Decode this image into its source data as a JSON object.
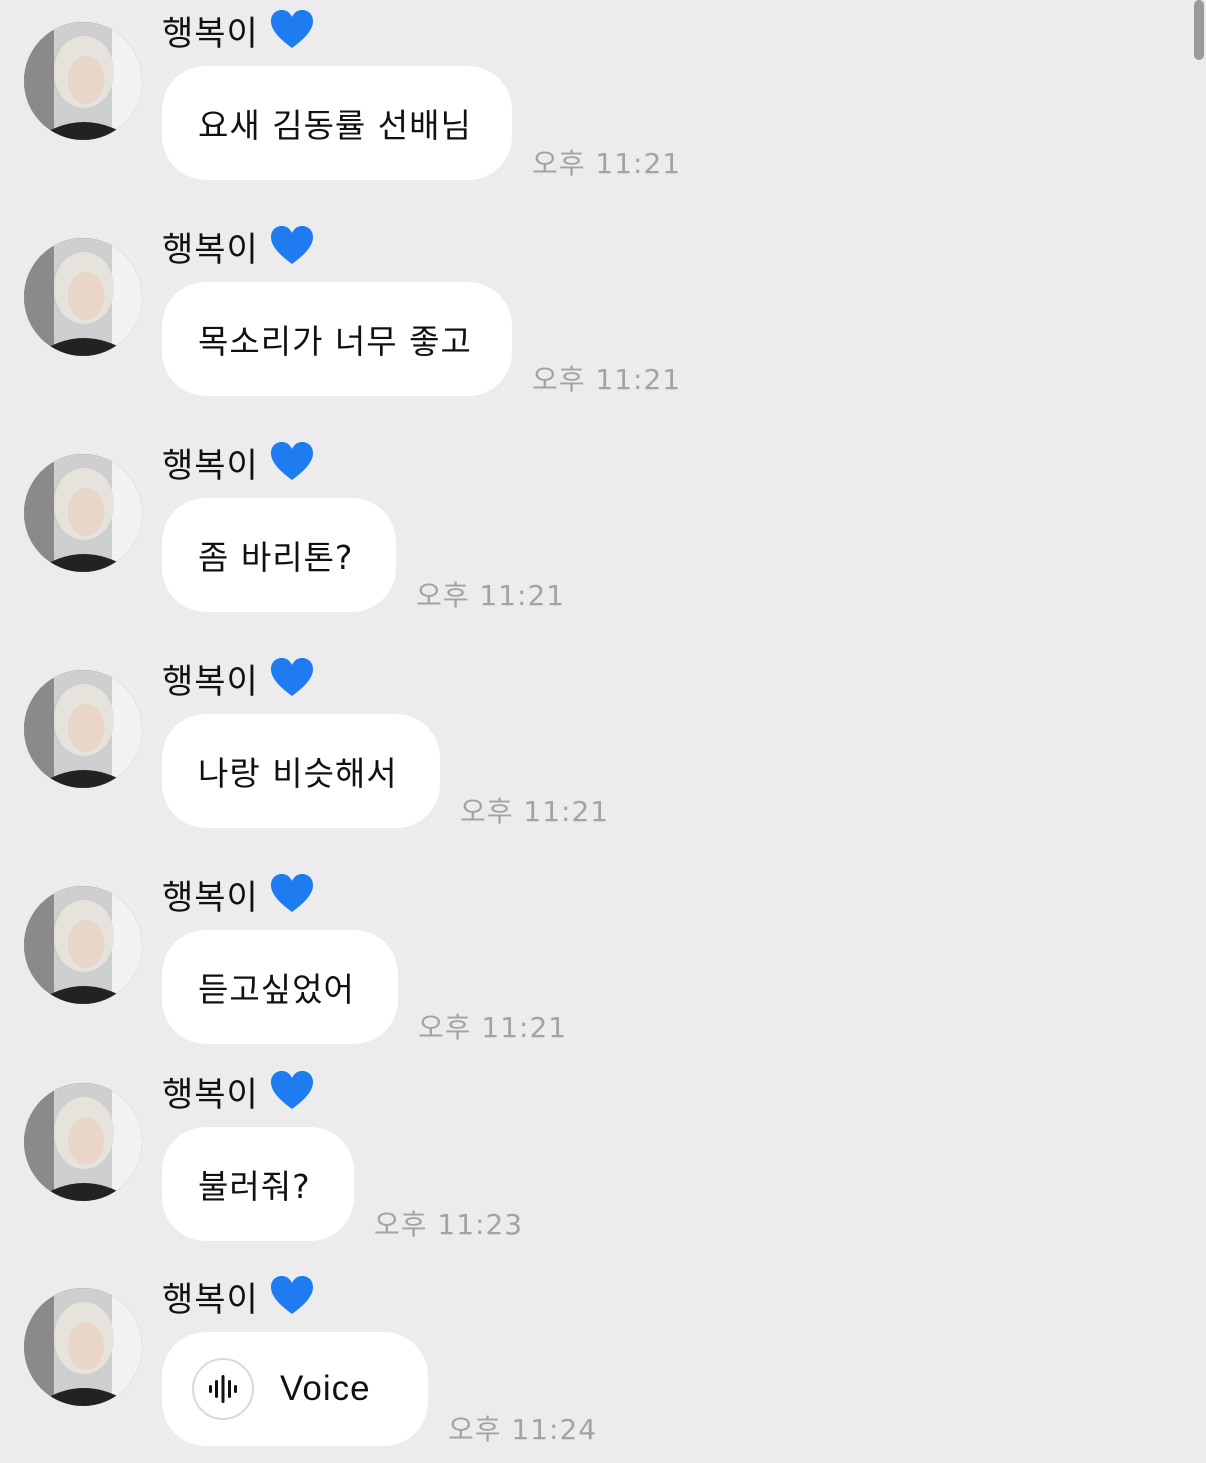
{
  "messages": [
    {
      "sender": "행복이",
      "text": "요새 김동률 선배님",
      "time": "오후 11:21"
    },
    {
      "sender": "행복이",
      "text": "목소리가 너무 좋고",
      "time": "오후 11:21"
    },
    {
      "sender": "행복이",
      "text": "좀 바리톤?",
      "time": "오후 11:21"
    },
    {
      "sender": "행복이",
      "text": "나랑 비슷해서",
      "time": "오후 11:21"
    },
    {
      "sender": "행복이",
      "text": "듣고싶었어",
      "time": "오후 11:21"
    },
    {
      "sender": "행복이",
      "text": "불러줘?",
      "time": "오후 11:23"
    },
    {
      "sender": "행복이",
      "text": "Voice",
      "time": "오후 11:24",
      "icon": "waveform-icon"
    }
  ],
  "colors": {
    "background": "#ececec",
    "bubble": "#ffffff",
    "heart": "#1e7cf0",
    "timestamp": "#a3a3a3"
  },
  "icons": {
    "sender_badge": "blue-heart-icon",
    "voice": "waveform-icon"
  }
}
